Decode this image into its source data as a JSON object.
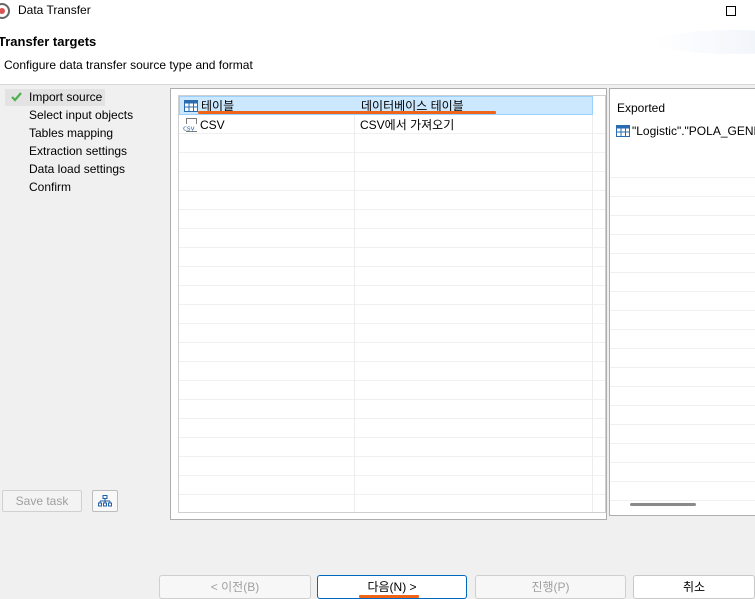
{
  "window": {
    "title": "Data Transfer"
  },
  "header": {
    "title": "Transfer targets",
    "description": "Configure data transfer source type and format"
  },
  "nav": {
    "items": [
      {
        "label": "Import source",
        "active": true
      },
      {
        "label": "Select input objects",
        "active": false
      },
      {
        "label": "Tables mapping",
        "active": false
      },
      {
        "label": "Extraction settings",
        "active": false
      },
      {
        "label": "Data load settings",
        "active": false
      },
      {
        "label": "Confirm",
        "active": false
      }
    ],
    "save_task_label": "Save task"
  },
  "sources": [
    {
      "name": "테이블",
      "description": "데이터베이스 테이블",
      "icon": "table-icon",
      "selected": true
    },
    {
      "name": "CSV",
      "description": "CSV에서 가져오기",
      "icon": "csv-icon",
      "selected": false
    }
  ],
  "exported": {
    "header": "Exported",
    "items": [
      "\"Logistic\".\"POLA_GENE"
    ]
  },
  "buttons": {
    "back": "< 이전(B)",
    "next": "다음(N) >",
    "proceed": "진행(P)",
    "cancel": "취소"
  },
  "colors": {
    "accent": "#0067c0",
    "selection": "#cce8ff",
    "annotation": "#f06418",
    "check": "#4caf50"
  }
}
